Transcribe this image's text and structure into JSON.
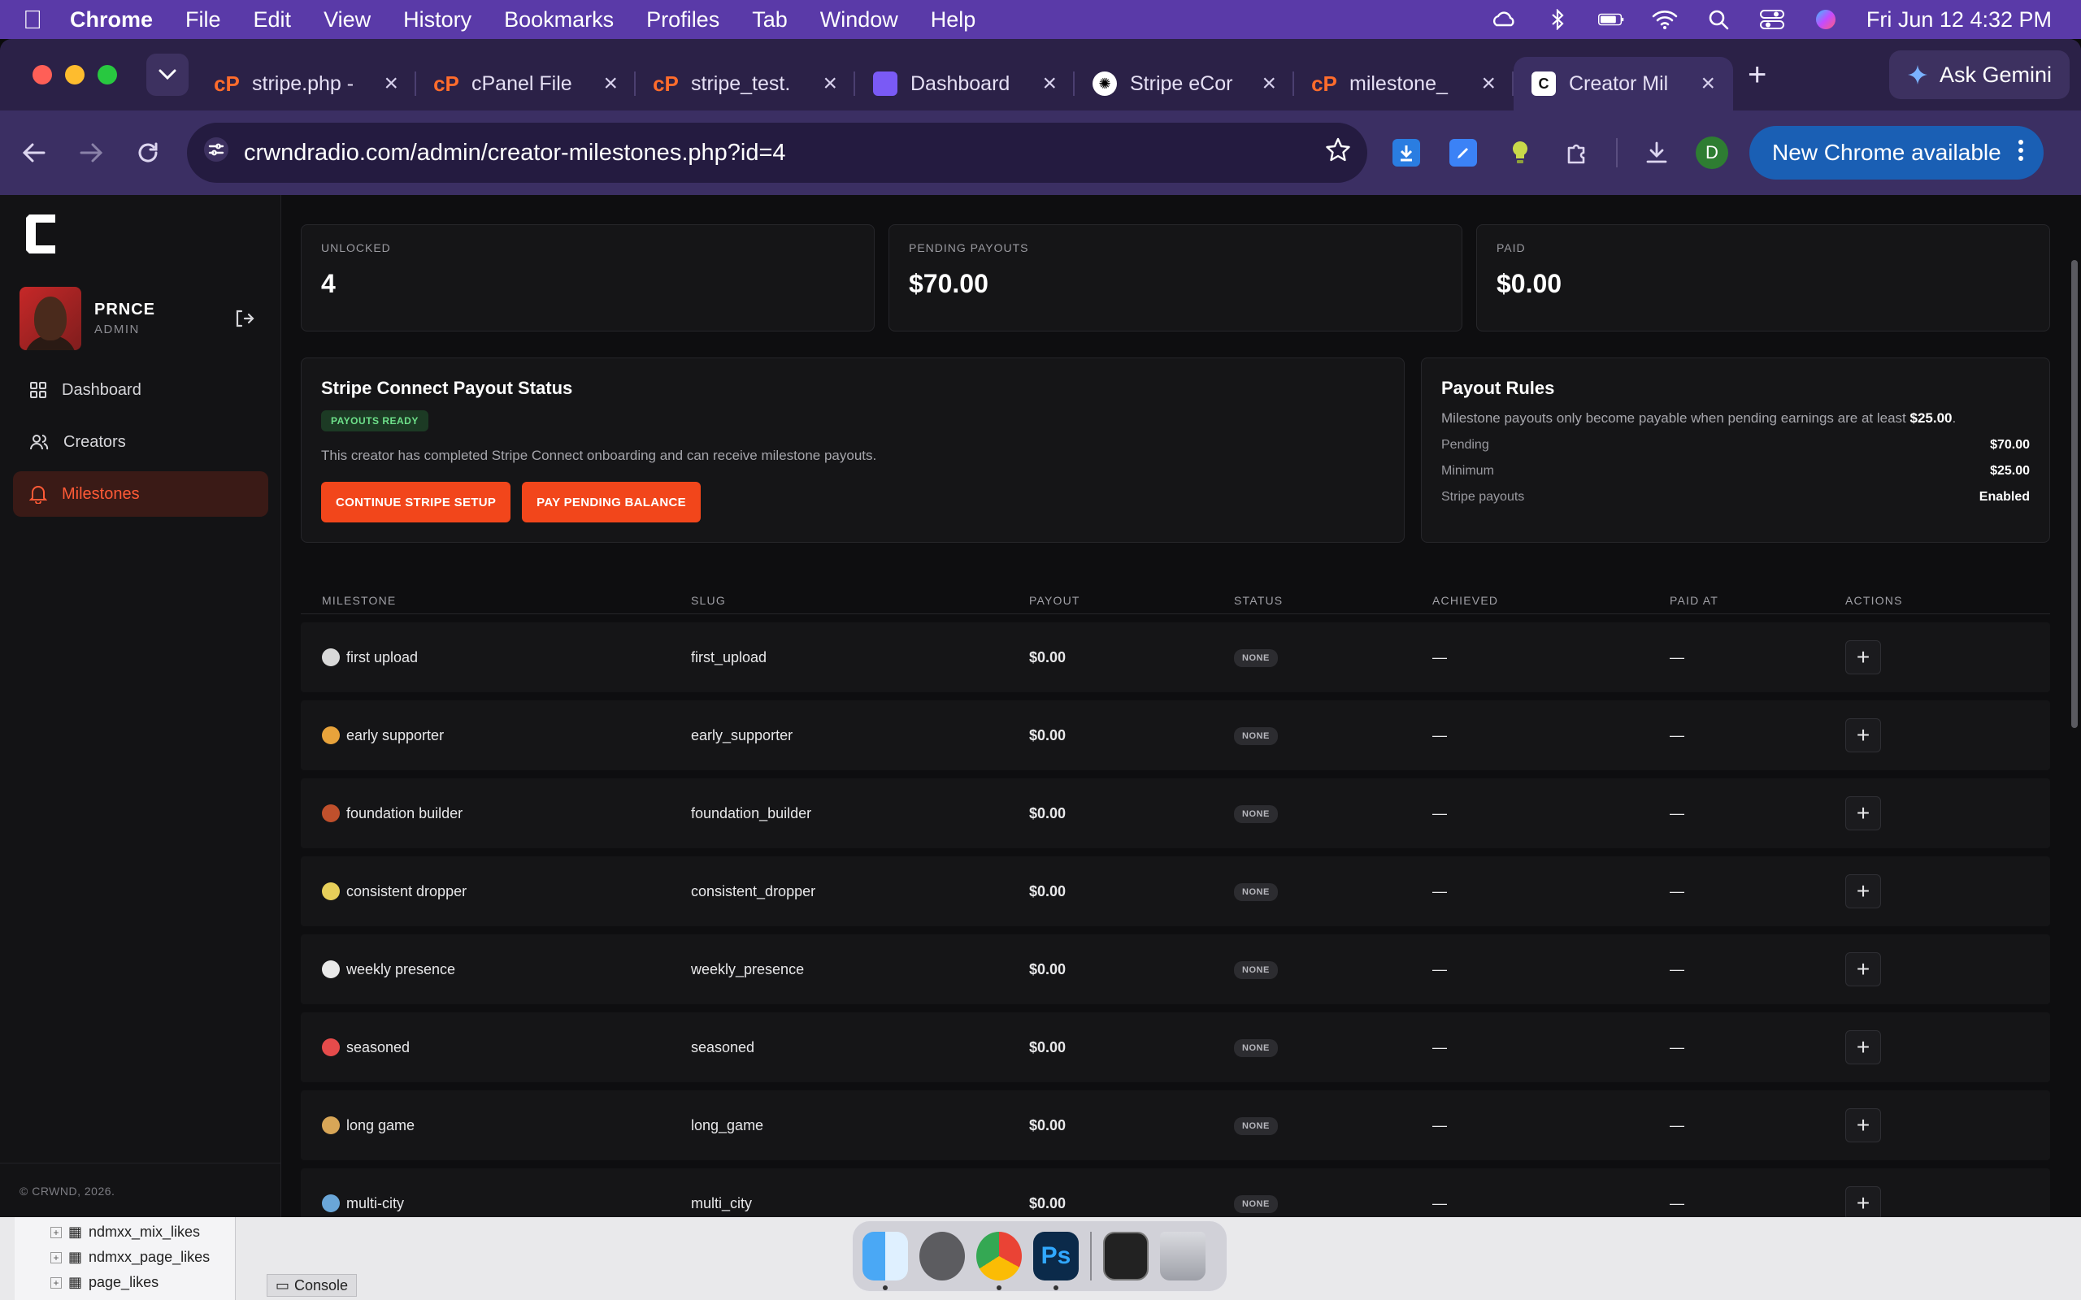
{
  "menubar": {
    "app": "Chrome",
    "items": [
      "File",
      "Edit",
      "View",
      "History",
      "Bookmarks",
      "Profiles",
      "Tab",
      "Window",
      "Help"
    ],
    "clock": "Fri Jun 12  4:32 PM"
  },
  "tabs": [
    {
      "title": "stripe.php -",
      "favicon": "cpanel-icon"
    },
    {
      "title": "cPanel File",
      "favicon": "cpanel-icon"
    },
    {
      "title": "stripe_test.",
      "favicon": "cpanel-icon"
    },
    {
      "title": "Dashboard",
      "favicon": "dashboard-icon"
    },
    {
      "title": "Stripe eCor",
      "favicon": "chatgpt-icon"
    },
    {
      "title": "milestone_",
      "favicon": "cpanel-icon"
    },
    {
      "title": "Creator Mil",
      "favicon": "crwnd-icon",
      "active": true
    }
  ],
  "ask_gemini": "Ask Gemini",
  "address": "crwndradio.com/admin/creator-milestones.php?id=4",
  "new_chrome": "New Chrome available",
  "profile_initial": "D",
  "sidebar": {
    "user_name": "PRNCE",
    "user_role": "ADMIN",
    "nav": [
      {
        "label": "Dashboard",
        "icon": "grid-icon"
      },
      {
        "label": "Creators",
        "icon": "users-icon"
      },
      {
        "label": "Milestones",
        "icon": "bell-icon",
        "active": true
      }
    ],
    "footer": "© CRWND, 2026."
  },
  "stats": [
    {
      "label": "UNLOCKED",
      "value": "4"
    },
    {
      "label": "PENDING PAYOUTS",
      "value": "$70.00"
    },
    {
      "label": "PAID",
      "value": "$0.00"
    }
  ],
  "stripe_card": {
    "title": "Stripe Connect Payout Status",
    "badge": "PAYOUTS READY",
    "text": "This creator has completed Stripe Connect onboarding and can receive milestone payouts.",
    "btn_continue": "CONTINUE STRIPE SETUP",
    "btn_pay": "PAY PENDING BALANCE"
  },
  "rules_card": {
    "title": "Payout Rules",
    "text": "Milestone payouts only become payable when pending earnings are at least",
    "threshold": "$25.00",
    "rows": [
      {
        "k": "Pending",
        "v": "$70.00"
      },
      {
        "k": "Minimum",
        "v": "$25.00"
      },
      {
        "k": "Stripe payouts",
        "v": "Enabled"
      }
    ]
  },
  "table": {
    "headers": [
      "MILESTONE",
      "SLUG",
      "PAYOUT",
      "STATUS",
      "ACHIEVED",
      "PAID AT",
      "ACTIONS"
    ],
    "rows": [
      {
        "name": "first upload",
        "slug": "first_upload",
        "payout": "$0.00",
        "status": "NONE",
        "achieved": "—",
        "paid_at": "—",
        "icon_color": "#d9d9d9"
      },
      {
        "name": "early supporter",
        "slug": "early_supporter",
        "payout": "$0.00",
        "status": "NONE",
        "achieved": "—",
        "paid_at": "—",
        "icon_color": "#e8a33b"
      },
      {
        "name": "foundation builder",
        "slug": "foundation_builder",
        "payout": "$0.00",
        "status": "NONE",
        "achieved": "—",
        "paid_at": "—",
        "icon_color": "#c0502c"
      },
      {
        "name": "consistent dropper",
        "slug": "consistent_dropper",
        "payout": "$0.00",
        "status": "NONE",
        "achieved": "—",
        "paid_at": "—",
        "icon_color": "#e7cf5a"
      },
      {
        "name": "weekly presence",
        "slug": "weekly_presence",
        "payout": "$0.00",
        "status": "NONE",
        "achieved": "—",
        "paid_at": "—",
        "icon_color": "#e9e9e9"
      },
      {
        "name": "seasoned",
        "slug": "seasoned",
        "payout": "$0.00",
        "status": "NONE",
        "achieved": "—",
        "paid_at": "—",
        "icon_color": "#e54b4b"
      },
      {
        "name": "long game",
        "slug": "long_game",
        "payout": "$0.00",
        "status": "NONE",
        "achieved": "—",
        "paid_at": "—",
        "icon_color": "#d8a657"
      },
      {
        "name": "multi-city",
        "slug": "multi_city",
        "payout": "$0.00",
        "status": "NONE",
        "achieved": "—",
        "paid_at": "—",
        "icon_color": "#6aa6d8"
      }
    ]
  },
  "desktop": {
    "tree": [
      "ndmxx_mix_likes",
      "ndmxx_page_likes",
      "page_likes"
    ],
    "console_tab": "Console"
  },
  "colors": {
    "accent": "#f2461b",
    "menubar": "#5a3aa8",
    "chrome_toolbar": "#3b2f63",
    "ready_green": "#6ee08a"
  }
}
